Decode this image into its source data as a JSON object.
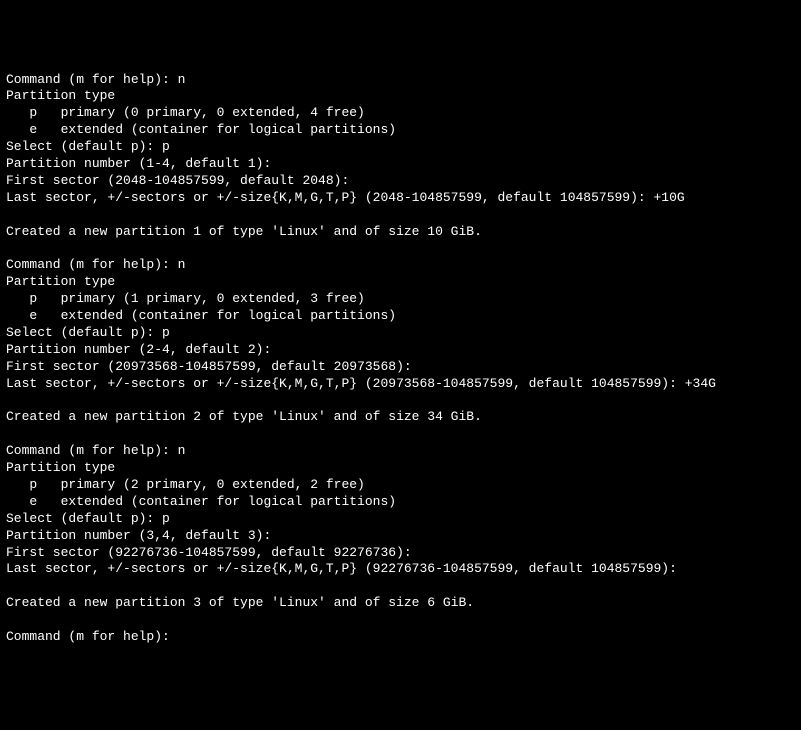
{
  "lines": [
    "Command (m for help): n",
    "Partition type",
    "   p   primary (0 primary, 0 extended, 4 free)",
    "   e   extended (container for logical partitions)",
    "Select (default p): p",
    "Partition number (1-4, default 1):",
    "First sector (2048-104857599, default 2048):",
    "Last sector, +/-sectors or +/-size{K,M,G,T,P} (2048-104857599, default 104857599): +10G",
    "",
    "Created a new partition 1 of type 'Linux' and of size 10 GiB.",
    "",
    "Command (m for help): n",
    "Partition type",
    "   p   primary (1 primary, 0 extended, 3 free)",
    "   e   extended (container for logical partitions)",
    "Select (default p): p",
    "Partition number (2-4, default 2):",
    "First sector (20973568-104857599, default 20973568):",
    "Last sector, +/-sectors or +/-size{K,M,G,T,P} (20973568-104857599, default 104857599): +34G",
    "",
    "Created a new partition 2 of type 'Linux' and of size 34 GiB.",
    "",
    "Command (m for help): n",
    "Partition type",
    "   p   primary (2 primary, 0 extended, 2 free)",
    "   e   extended (container for logical partitions)",
    "Select (default p): p",
    "Partition number (3,4, default 3):",
    "First sector (92276736-104857599, default 92276736):",
    "Last sector, +/-sectors or +/-size{K,M,G,T,P} (92276736-104857599, default 104857599):",
    "",
    "Created a new partition 3 of type 'Linux' and of size 6 GiB.",
    "",
    "Command (m for help):"
  ]
}
